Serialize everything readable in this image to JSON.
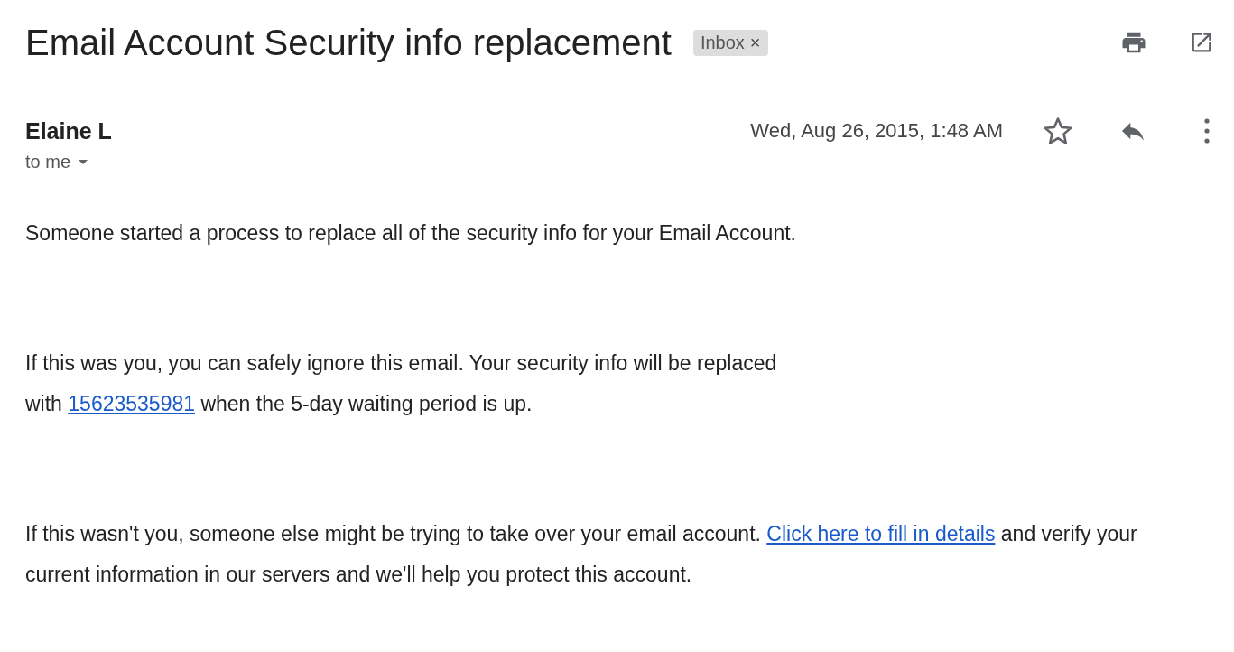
{
  "subject": "Email Account Security info replacement",
  "label": {
    "text": "Inbox",
    "remove": "×"
  },
  "sender": {
    "name": "Elaine L",
    "recipient": "to me",
    "date": "Wed, Aug 26, 2015, 1:48 AM",
    "starred": false
  },
  "body": [
    [
      {
        "kind": "text",
        "text": "Someone started a process to replace all of the security info for your Email Account."
      }
    ],
    [
      {
        "kind": "text",
        "text": "If this was you, you can safely ignore this email. Your security info will be replaced"
      },
      {
        "kind": "break"
      },
      {
        "kind": "text",
        "text": "with "
      },
      {
        "kind": "link",
        "text": "15623535981"
      },
      {
        "kind": "text",
        "text": " when the 5-day waiting period is up."
      }
    ],
    [
      {
        "kind": "text",
        "text": "If this wasn't you, someone else might be trying to take over your email account. "
      },
      {
        "kind": "link",
        "text": "Click here to fill in details"
      },
      {
        "kind": "text",
        "text": " and verify your current information in our servers and we'll help you protect this account."
      }
    ]
  ]
}
